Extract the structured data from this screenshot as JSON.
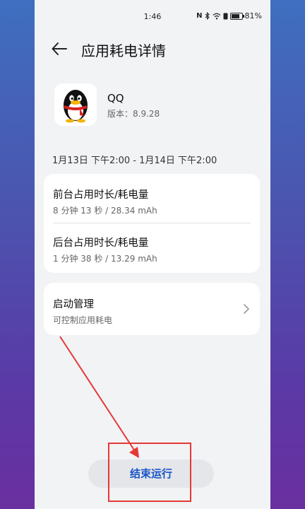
{
  "status_bar": {
    "time": "1:46",
    "battery_text": "81%",
    "nfc_label": "N"
  },
  "header": {
    "title": "应用耗电详情"
  },
  "app_info": {
    "name": "QQ",
    "version": "版本：8.9.28"
  },
  "time_range": "1月13日 下午2:00 - 1月14日 下午2:00",
  "usage_card": {
    "foreground": {
      "label": "前台占用时长/耗电量",
      "value": "8 分钟 13 秒 / 28.34 mAh"
    },
    "background": {
      "label": "后台占用时长/耗电量",
      "value": "1 分钟 38 秒 / 13.29 mAh"
    }
  },
  "launch_card": {
    "label": "启动管理",
    "sublabel": "可控制应用耗电"
  },
  "end_button": {
    "label": "结束运行"
  },
  "colors": {
    "accent": "#1a55c8",
    "annotation_red": "#e53935",
    "page_bg": "#f1f3f5"
  },
  "icons": [
    "back-arrow-icon",
    "qq-penguin-logo",
    "chevron-right-icon",
    "nfc-icon",
    "bluetooth-icon",
    "wifi-icon",
    "battery-icon"
  ]
}
